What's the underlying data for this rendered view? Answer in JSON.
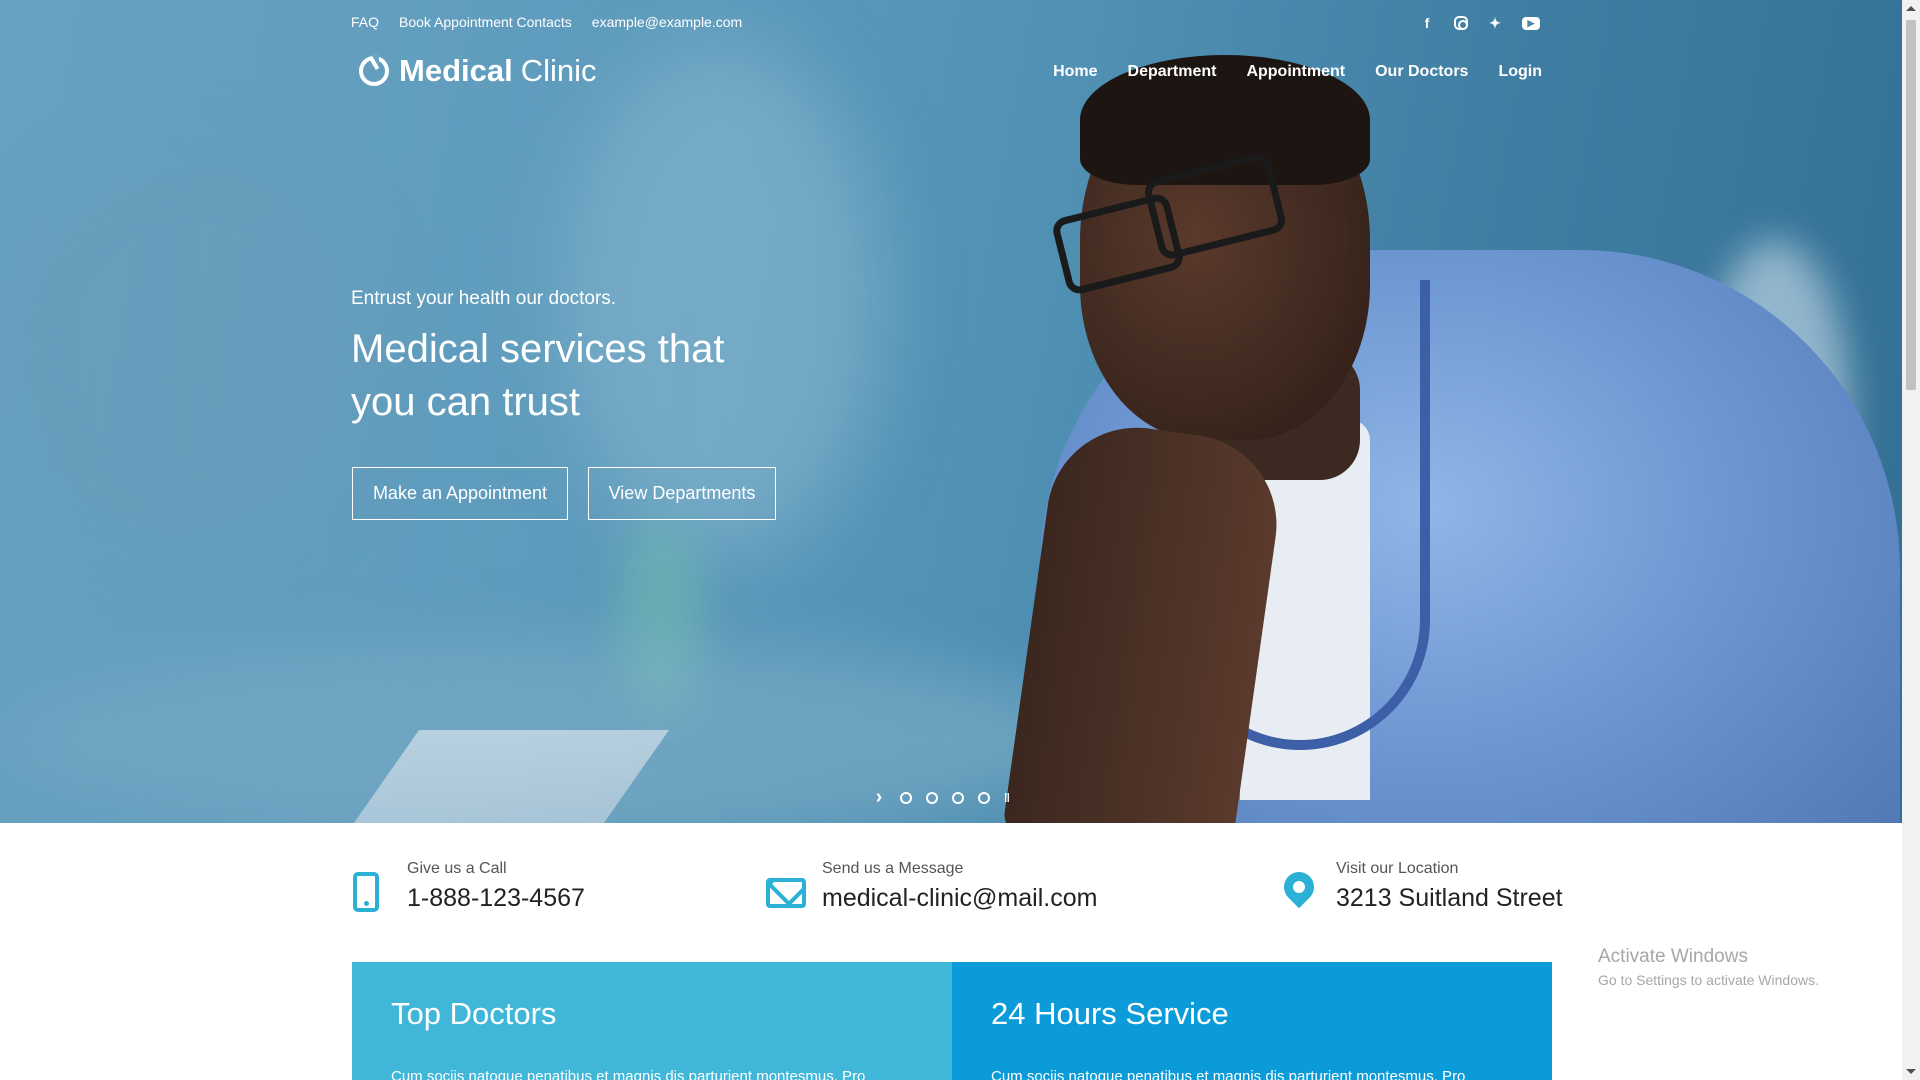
{
  "topbar": {
    "links": [
      "FAQ",
      "Book Appointment Contacts",
      "example@example.com"
    ],
    "social": [
      "facebook-icon",
      "instagram-icon",
      "twitter-icon",
      "youtube-icon"
    ]
  },
  "logo": {
    "strong": "Medical",
    "light": "Clinic"
  },
  "nav": [
    "Home",
    "Department",
    "Appointment",
    "Our Doctors",
    "Login"
  ],
  "hero": {
    "kicker": "Entrust your health our doctors.",
    "headline": "Medical services that you can trust",
    "buttons": [
      "Make an Appointment",
      "View Departments"
    ]
  },
  "slider": {
    "dot_count": 4
  },
  "contacts": [
    {
      "label": "Give us a Call",
      "value": "1-888-123-4567",
      "icon": "phone-icon"
    },
    {
      "label": "Send us a Message",
      "value": "medical-clinic@mail.com",
      "icon": "mail-icon"
    },
    {
      "label": "Visit our Location",
      "value": "3213 Suitland Street",
      "icon": "location-pin-icon"
    }
  ],
  "panels": [
    {
      "title": "Top Doctors",
      "text": "Cum sociis natoque penatibus et magnis dis parturient montesmus. Pro"
    },
    {
      "title": "24 Hours Service",
      "text": "Cum sociis natoque penatibus et magnis dis parturient montesmus. Pro"
    }
  ],
  "watermark": {
    "title": "Activate Windows",
    "subtitle": "Go to Settings to activate Windows."
  },
  "colors": {
    "accent": "#2bb0d6",
    "panel_left": "#40b7d9",
    "panel_right": "#0c9bd9",
    "hero": "#5e9dbd"
  }
}
